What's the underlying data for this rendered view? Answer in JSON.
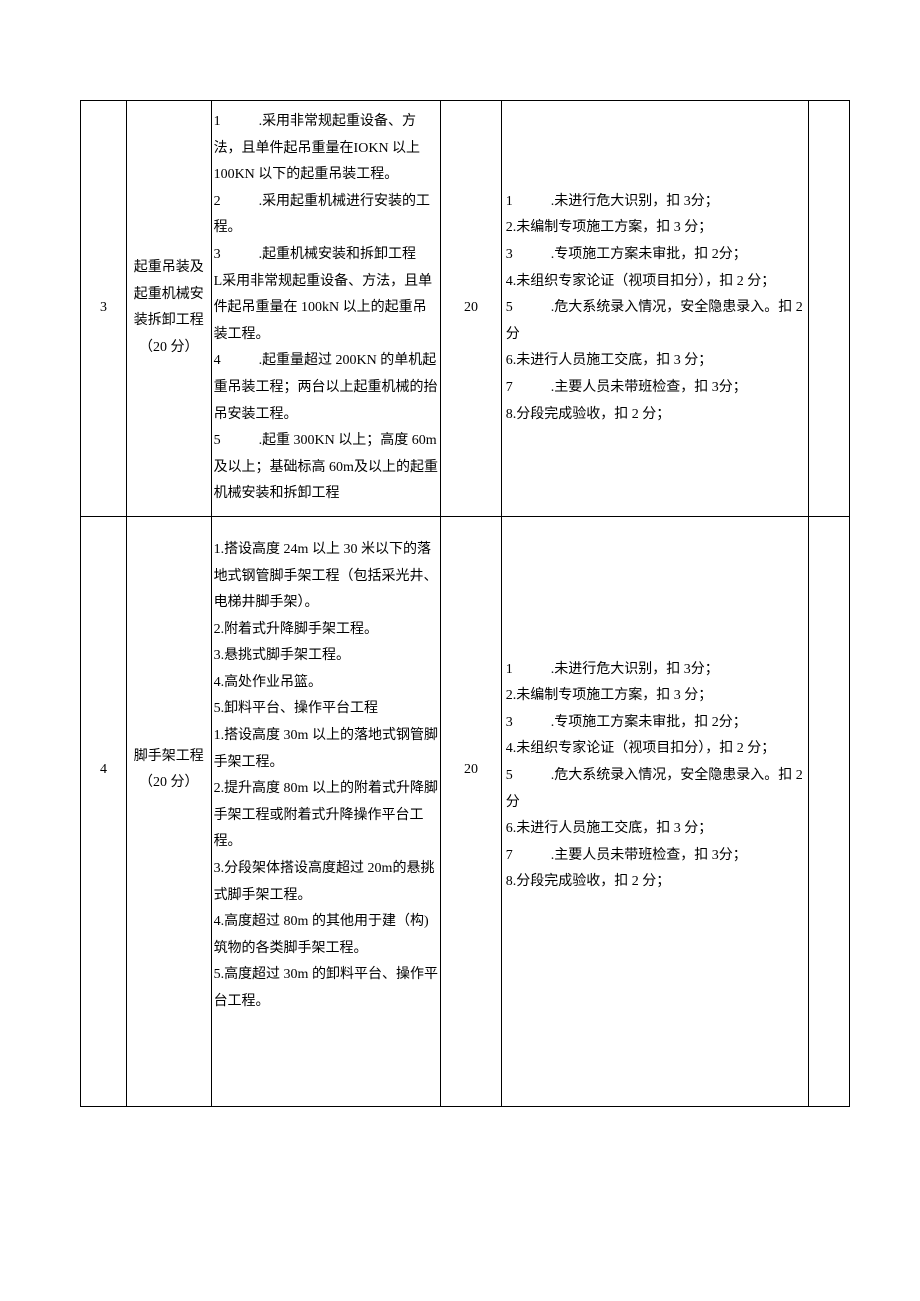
{
  "rows": [
    {
      "idx": "3",
      "title": "起重吊装及起重机械安装拆卸工程（20 分）",
      "desc": "1　　　.采用非常规起重设备、方法，且单件起吊重量在IOKN 以上 100KN 以下的起重吊装工程。\n2　　　.采用起重机械进行安装的工程。\n3　　　.起重机械安装和拆卸工程\nL采用非常规起重设备、方法，且单件起吊重量在 100kN 以上的起重吊装工程。\n4　　　.起重量超过 200KN 的单机起重吊装工程；两台以上起重机械的抬吊安装工程。\n5　　　.起重 300KN 以上；高度 60m 及以上；基础标高 60m及以上的起重机械安装和拆卸工程",
      "score": "20",
      "criteria": "1　　　.未进行危大识别，扣 3分；\n2.未编制专项施工方案，扣 3 分；\n3　　　.专项施工方案未审批，扣 2分；\n4.未组织专家论证（视项目扣分），扣 2 分；\n5　　　.危大系统录入情况，安全隐患录入。扣 2 分\n6.未进行人员施工交底，扣 3 分；\n7　　　.主要人员未带班检查，扣 3分；\n8.分段完成验收，扣 2 分；"
    },
    {
      "idx": "4",
      "title": "脚手架工程（20 分）",
      "desc": "1.搭设高度 24m 以上 30 米以下的落地式钢管脚手架工程（包括采光井、电梯井脚手架）。\n2.附着式升降脚手架工程。\n3.悬挑式脚手架工程。\n4.高处作业吊篮。\n5.卸料平台、操作平台工程\n1.搭设高度 30m 以上的落地式钢管脚手架工程。\n2.提升高度 80m 以上的附着式升降脚手架工程或附着式升降操作平台工程。\n3.分段架体搭设高度超过 20m的悬挑式脚手架工程。\n4.高度超过 80m 的其他用于建（构)筑物的各类脚手架工程。\n5.高度超过 30m 的卸料平台、操作平台工程。",
      "score": "20",
      "criteria": "1　　　.未进行危大识别，扣 3分；\n2.未编制专项施工方案，扣 3 分；\n3　　　.专项施工方案未审批，扣 2分；\n4.未组织专家论证（视项目扣分），扣 2 分；\n5　　　.危大系统录入情况，安全隐患录入。扣 2 分\n6.未进行人员施工交底，扣 3 分；\n7　　　.主要人员未带班检查，扣 3分；\n8.分段完成验收，扣 2 分；"
    }
  ]
}
